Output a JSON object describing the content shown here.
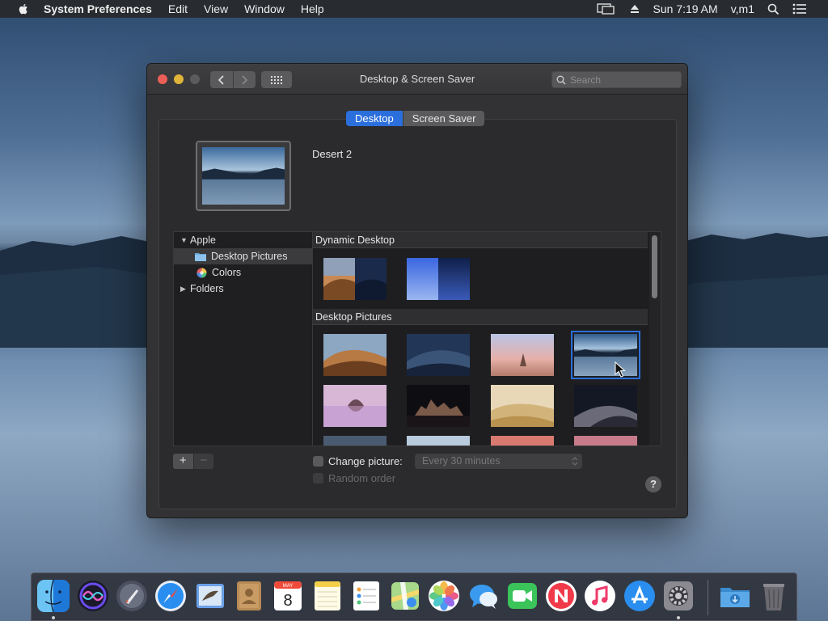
{
  "menubar": {
    "app": "System Preferences",
    "menus": [
      "Edit",
      "View",
      "Window",
      "Help"
    ],
    "clock": "Sun 7:19 AM",
    "user": "v,m1"
  },
  "window": {
    "title": "Desktop & Screen Saver",
    "search_placeholder": "Search",
    "tabs": [
      "Desktop",
      "Screen Saver"
    ],
    "active_tab": "Desktop",
    "wallpaper_name": "Desert 2"
  },
  "sidebar": {
    "items": [
      "Apple",
      "Desktop Pictures",
      "Colors",
      "Folders"
    ]
  },
  "gallery": {
    "sections": [
      "Dynamic Desktop",
      "Desktop Pictures"
    ]
  },
  "controls": {
    "add": "+",
    "remove": "−",
    "change_picture": "Change picture:",
    "interval": "Every 30 minutes",
    "random_order": "Random order",
    "help": "?"
  },
  "colors": {
    "accent": "#2b6fdc"
  }
}
